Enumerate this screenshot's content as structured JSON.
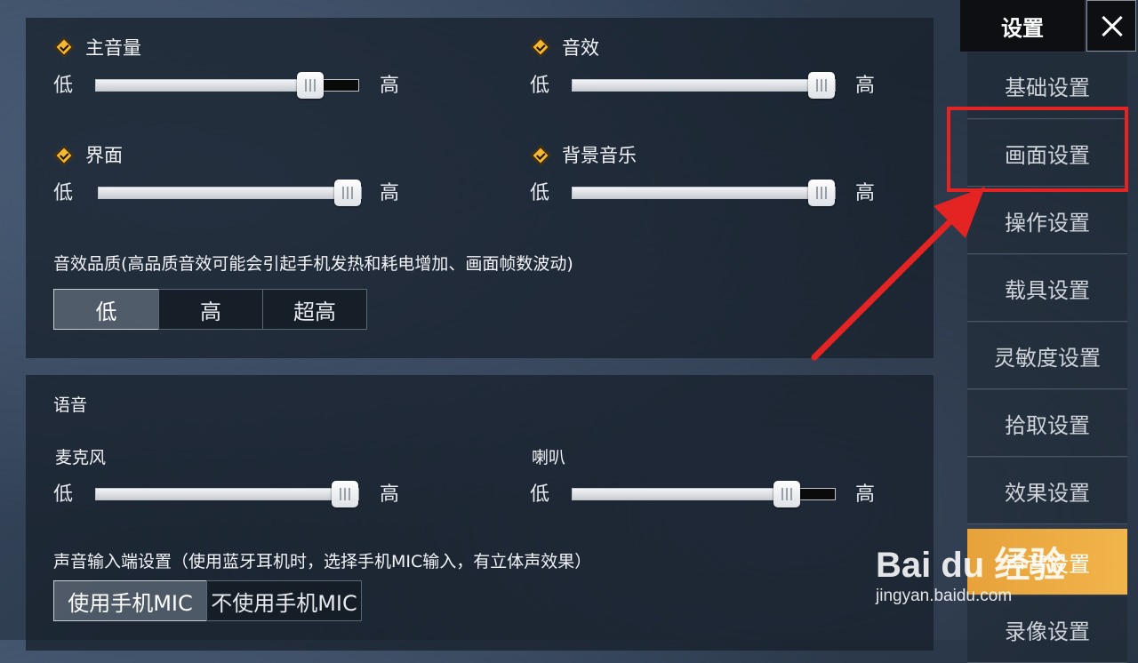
{
  "audio": {
    "main_volume": {
      "label": "主音量",
      "value": 0.81
    },
    "sfx": {
      "label": "音效",
      "value": 1.0
    },
    "ui": {
      "label": "界面",
      "value": 1.0
    },
    "bgm": {
      "label": "背景音乐",
      "value": 1.0
    },
    "low_label": "低",
    "high_label": "高",
    "quality": {
      "label": "音效品质(高品质音效可能会引起手机发热和耗电增加、画面帧数波动)",
      "options": [
        "低",
        "高",
        "超高"
      ],
      "selected": "低"
    }
  },
  "voice": {
    "title": "语音",
    "mic": {
      "label": "麦克风",
      "value": 1.0
    },
    "speaker": {
      "label": "喇叭",
      "value": 0.81
    },
    "input": {
      "label": "声音输入端设置（使用蓝牙耳机时，选择手机MIC输入，有立体声效果）",
      "options": [
        "使用手机MIC",
        "不使用手机MIC"
      ],
      "selected": "使用手机MIC"
    }
  },
  "sidebar": {
    "title": "设置",
    "items": [
      {
        "label": "基础设置"
      },
      {
        "label": "画面设置"
      },
      {
        "label": "操作设置"
      },
      {
        "label": "载具设置"
      },
      {
        "label": "灵敏度设置"
      },
      {
        "label": "拾取设置"
      },
      {
        "label": "效果设置"
      },
      {
        "label": "声音设置"
      },
      {
        "label": "录像设置"
      }
    ],
    "active": "声音设置"
  },
  "watermark": {
    "brand": "Bai du 经验",
    "url": "jingyan.baidu.com"
  },
  "colors": {
    "accent": "#f1b54b",
    "highlight": "#e42323",
    "check": "#f4b733"
  }
}
